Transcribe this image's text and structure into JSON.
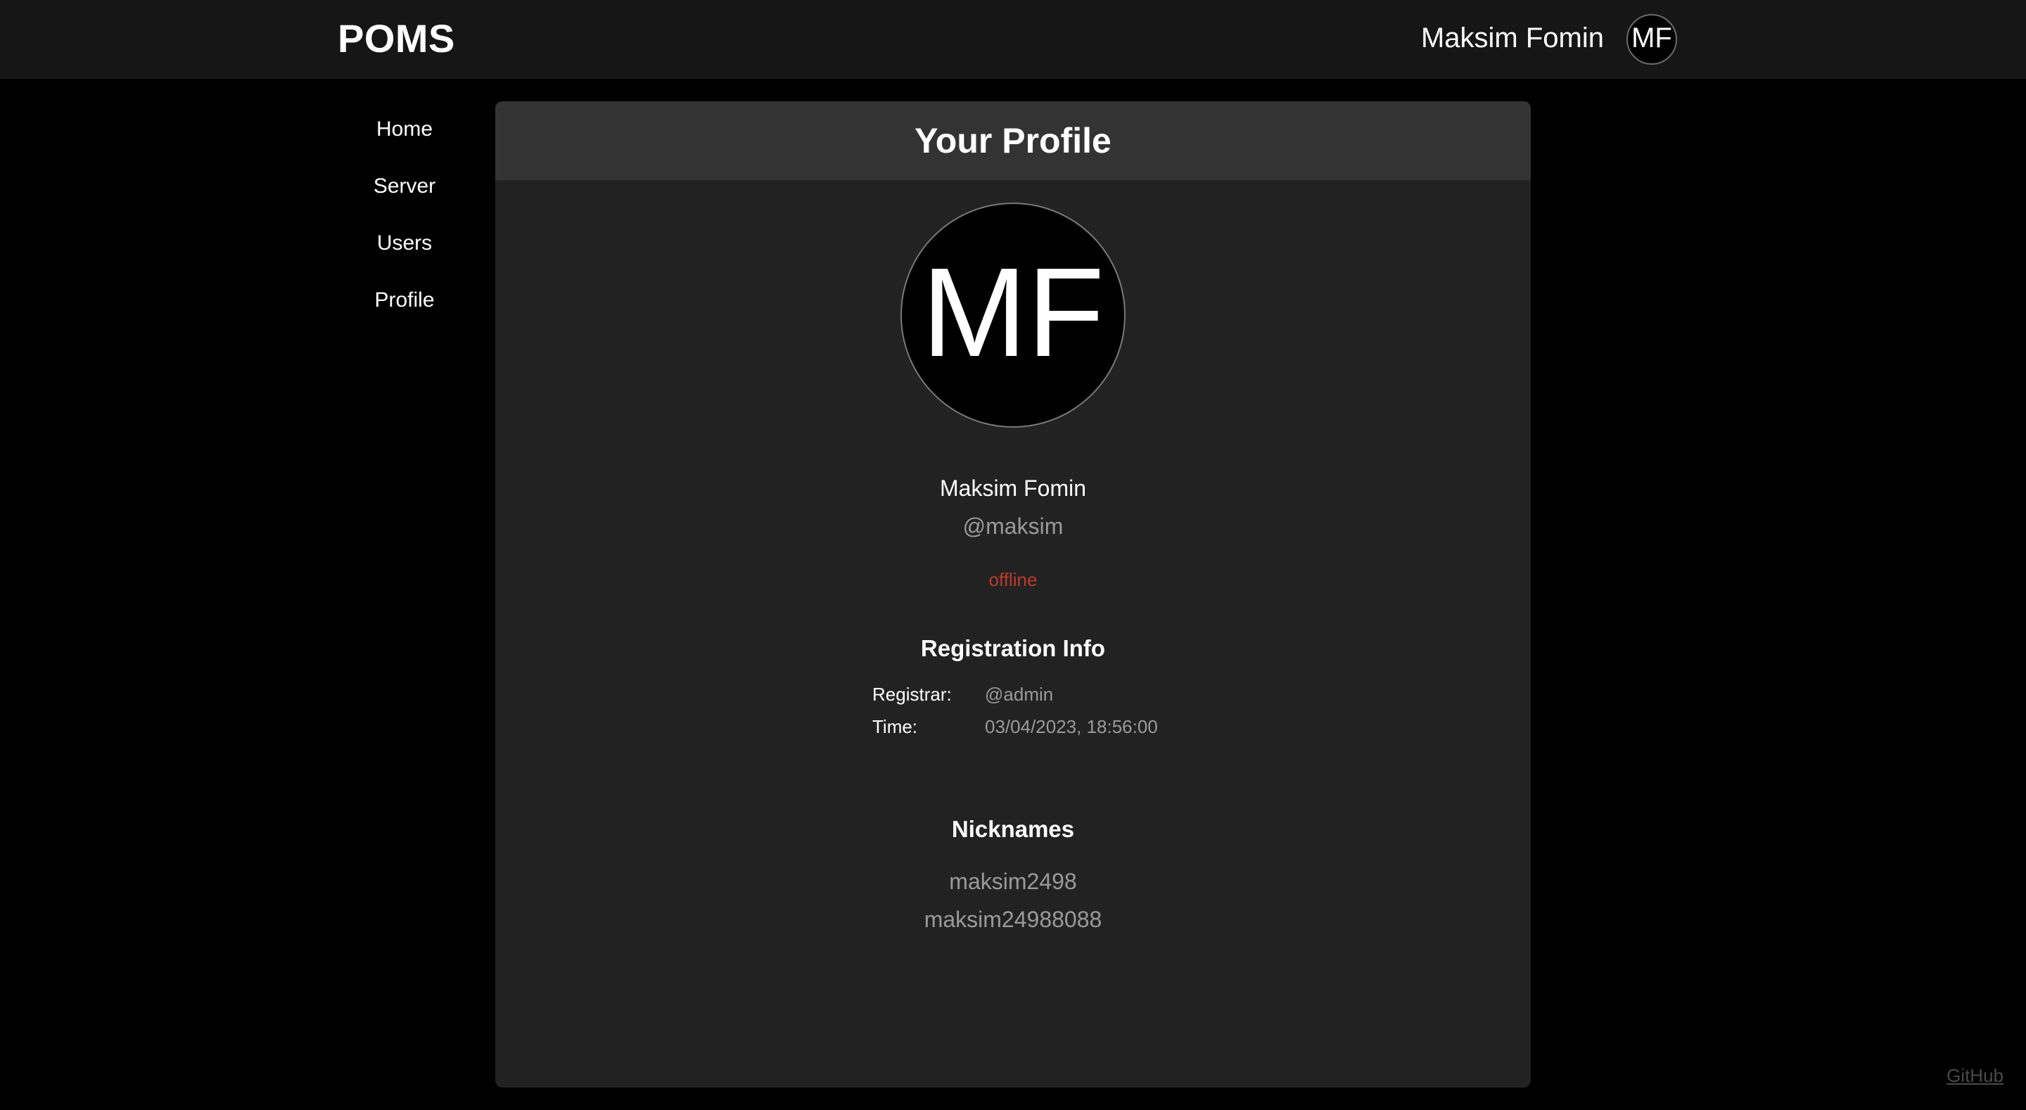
{
  "header": {
    "brand": "POMS",
    "user_name": "Maksim Fomin",
    "user_initials": "MF"
  },
  "sidebar": {
    "items": [
      {
        "label": "Home"
      },
      {
        "label": "Server"
      },
      {
        "label": "Users"
      },
      {
        "label": "Profile"
      }
    ]
  },
  "profile": {
    "title": "Your Profile",
    "initials": "MF",
    "full_name": "Maksim Fomin",
    "username": "@maksim",
    "status": "offline",
    "status_color": "#c0392b",
    "registration": {
      "title": "Registration Info",
      "registrar_label": "Registrar:",
      "registrar_value": "@admin",
      "time_label": "Time:",
      "time_value": "03/04/2023, 18:56:00"
    },
    "nicknames": {
      "title": "Nicknames",
      "items": [
        "maksim2498",
        "maksim24988088"
      ]
    }
  },
  "footer": {
    "github_label": "GitHub"
  }
}
